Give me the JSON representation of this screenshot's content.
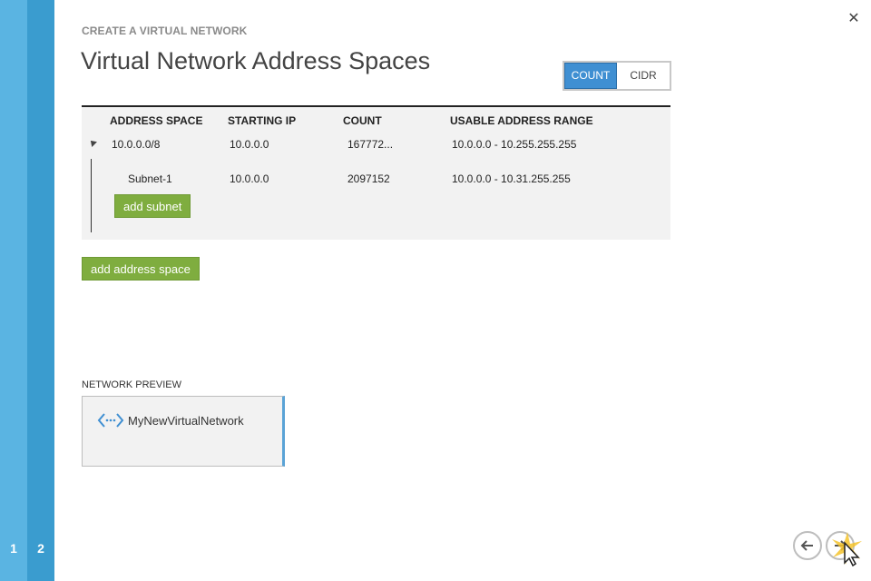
{
  "wizard": {
    "steps": [
      "1",
      "2"
    ],
    "eyebrow": "CREATE A VIRTUAL NETWORK",
    "title": "Virtual Network Address Spaces"
  },
  "toggle": {
    "count_label": "COUNT",
    "cidr_label": "CIDR",
    "selected": "COUNT"
  },
  "table": {
    "headers": [
      "ADDRESS SPACE",
      "STARTING IP",
      "COUNT",
      "USABLE ADDRESS RANGE"
    ],
    "address_space": {
      "name": "10.0.0.0/8",
      "starting_ip": "10.0.0.0",
      "count": "167772...",
      "range": "10.0.0.0 - 10.255.255.255"
    },
    "subnet": {
      "name": "Subnet-1",
      "starting_ip": "10.0.0.0",
      "count": "2097152",
      "range": "10.0.0.0 - 10.31.255.255"
    },
    "add_subnet_label": "add subnet"
  },
  "add_address_space_label": "add address space",
  "preview": {
    "label": "NETWORK PREVIEW",
    "network_name": "MyNewVirtualNetwork"
  },
  "colors": {
    "rail_light": "#5ab4e2",
    "rail_dark": "#3a9ccf",
    "accent_blue": "#3f8fd2",
    "button_green": "#7fad3f"
  },
  "icons": {
    "close": "close-icon",
    "network": "virtual-network-icon",
    "back": "arrow-left-icon",
    "next": "arrow-right-icon"
  }
}
